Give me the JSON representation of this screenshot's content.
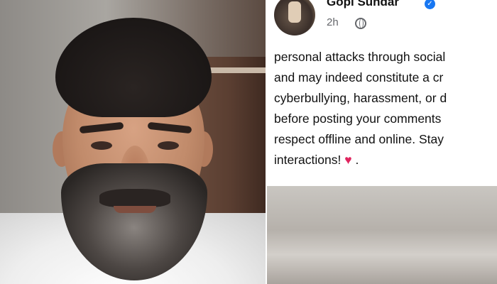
{
  "post": {
    "author": "Gopi Sundar",
    "time": "2h",
    "lines": [
      "personal attacks through social",
      "and may indeed constitute a cr",
      "cyberbullying, harassment, or d",
      "before posting your comments",
      "respect offline and online. Stay",
      "interactions! "
    ],
    "emoji": "♥",
    "end": " ."
  },
  "colors": {
    "verified": "#1877f2",
    "heart": "#e0245e",
    "meta_text": "#65676b"
  },
  "icons": {
    "verified": "check-badge-icon",
    "audience": "globe-icon"
  }
}
